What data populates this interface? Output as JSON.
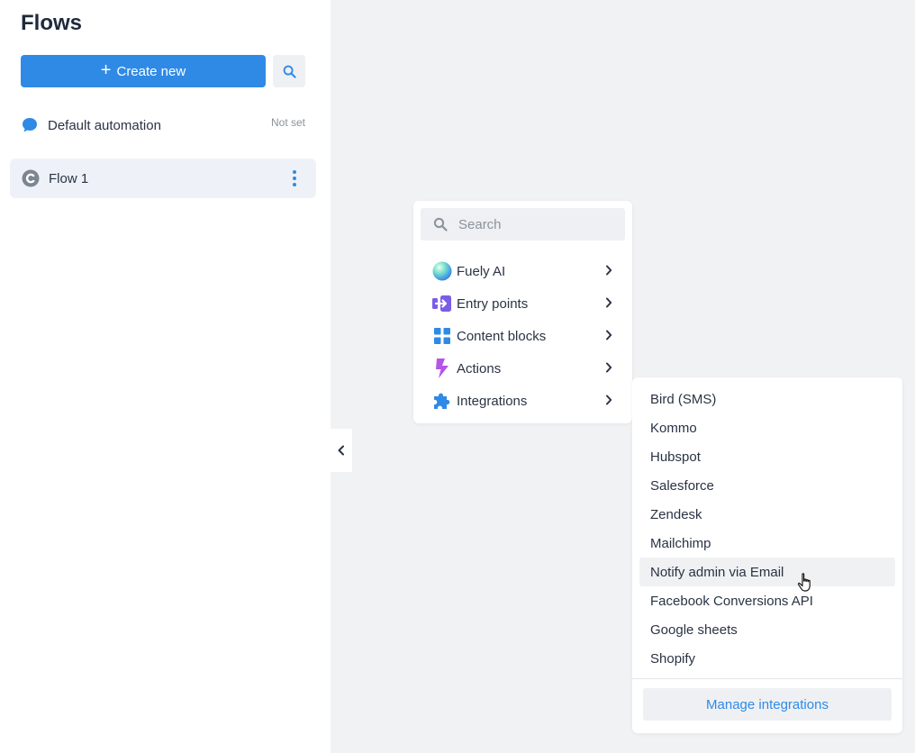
{
  "sidebar": {
    "title": "Flows",
    "create_label": "Create new",
    "default_automation": {
      "label": "Default automation",
      "status": "Not set"
    },
    "flows": [
      {
        "label": "Flow 1"
      }
    ]
  },
  "menu": {
    "search_placeholder": "Search",
    "items": [
      {
        "label": "Fuely AI",
        "icon": "fuely-ai-orb-icon"
      },
      {
        "label": "Entry points",
        "icon": "entry-arrow-icon"
      },
      {
        "label": "Content blocks",
        "icon": "grid-blocks-icon"
      },
      {
        "label": "Actions",
        "icon": "lightning-icon"
      },
      {
        "label": "Integrations",
        "icon": "puzzle-icon"
      }
    ]
  },
  "submenu": {
    "items": [
      "Bird (SMS)",
      "Kommo",
      "Hubspot",
      "Salesforce",
      "Zendesk",
      "Mailchimp",
      "Notify admin via Email",
      "Facebook Conversions API",
      "Google sheets",
      "Shopify"
    ],
    "manage_label": "Manage integrations"
  },
  "colors": {
    "accent": "#2f8ae6",
    "background": "#f1f2f4",
    "actions_icon": "#b455e8",
    "entry_icon": "#7b5ce6"
  }
}
